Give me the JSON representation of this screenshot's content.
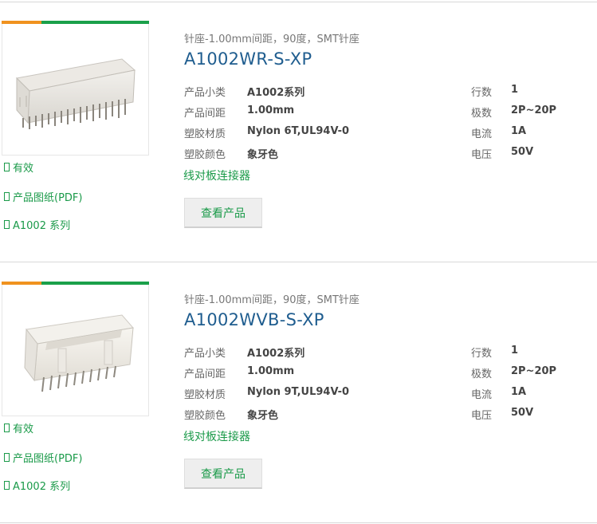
{
  "products": [
    {
      "subtitle": "针座-1.00mm间距，90度，SMT针座",
      "title": "A1002WR-S-XP",
      "specs_left": [
        {
          "key": "产品小类",
          "value": "A1002系列"
        },
        {
          "key": "产品间距",
          "value": "1.00mm"
        },
        {
          "key": "塑胶材质",
          "value": "Nylon 6T,UL94V-0"
        },
        {
          "key": "塑胶颜色",
          "value": "象牙色"
        }
      ],
      "specs_right": [
        {
          "key": "行数",
          "value": "1"
        },
        {
          "key": "极数",
          "value": "2P~20P"
        },
        {
          "key": "电流",
          "value": "1A"
        },
        {
          "key": "电压",
          "value": "50V"
        }
      ],
      "category": "线对板连接器",
      "button": "查看产品",
      "links": [
        "有效",
        "产品图纸(PDF)",
        "A1002 系列"
      ],
      "image_icon": "connector-wr-photo"
    },
    {
      "subtitle": "针座-1.00mm间距，90度，SMT针座",
      "title": "A1002WVB-S-XP",
      "specs_left": [
        {
          "key": "产品小类",
          "value": "A1002系列"
        },
        {
          "key": "产品间距",
          "value": "1.00mm"
        },
        {
          "key": "塑胶材质",
          "value": "Nylon 9T,UL94V-0"
        },
        {
          "key": "塑胶颜色",
          "value": "象牙色"
        }
      ],
      "specs_right": [
        {
          "key": "行数",
          "value": "1"
        },
        {
          "key": "极数",
          "value": "2P~20P"
        },
        {
          "key": "电流",
          "value": "1A"
        },
        {
          "key": "电压",
          "value": "50V"
        }
      ],
      "category": "线对板连接器",
      "button": "查看产品",
      "links": [
        "有效",
        "产品图纸(PDF)",
        "A1002 系列"
      ],
      "image_icon": "connector-wvb-photo"
    }
  ],
  "colors": {
    "accent_green": "#1a9a49",
    "accent_orange": "#f0921e",
    "title_blue": "#1f5d8f"
  }
}
